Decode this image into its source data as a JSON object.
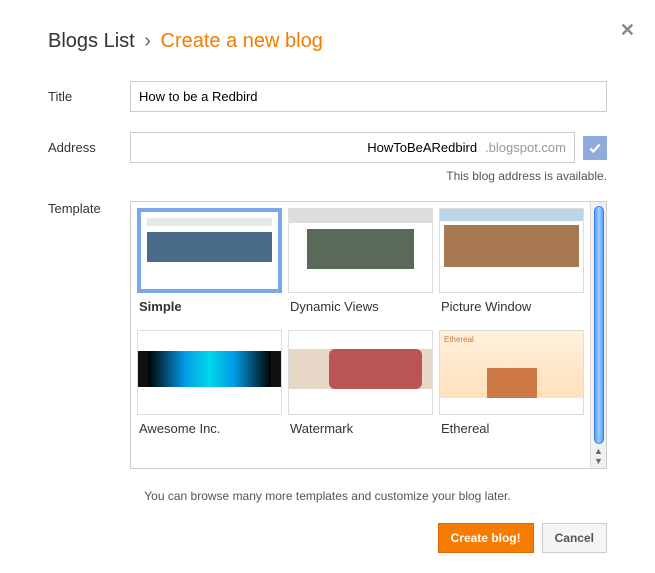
{
  "header": {
    "breadcrumb": "Blogs List",
    "separator": "›",
    "title": "Create a new blog"
  },
  "labels": {
    "title": "Title",
    "address": "Address",
    "template": "Template"
  },
  "title_input": {
    "value": "How to be a Redbird"
  },
  "address": {
    "value": "HowToBeARedbird",
    "suffix": ".blogspot.com",
    "status": "This blog address is available."
  },
  "templates": [
    {
      "name": "Simple",
      "selected": true,
      "thumb": "simple"
    },
    {
      "name": "Dynamic Views",
      "selected": false,
      "thumb": "dynamic"
    },
    {
      "name": "Picture Window",
      "selected": false,
      "thumb": "picture"
    },
    {
      "name": "Awesome Inc.",
      "selected": false,
      "thumb": "awesome"
    },
    {
      "name": "Watermark",
      "selected": false,
      "thumb": "watermark"
    },
    {
      "name": "Ethereal",
      "selected": false,
      "thumb": "ethereal"
    }
  ],
  "browse_msg": "You can browse many more templates and customize your blog later.",
  "buttons": {
    "create": "Create blog!",
    "cancel": "Cancel"
  }
}
